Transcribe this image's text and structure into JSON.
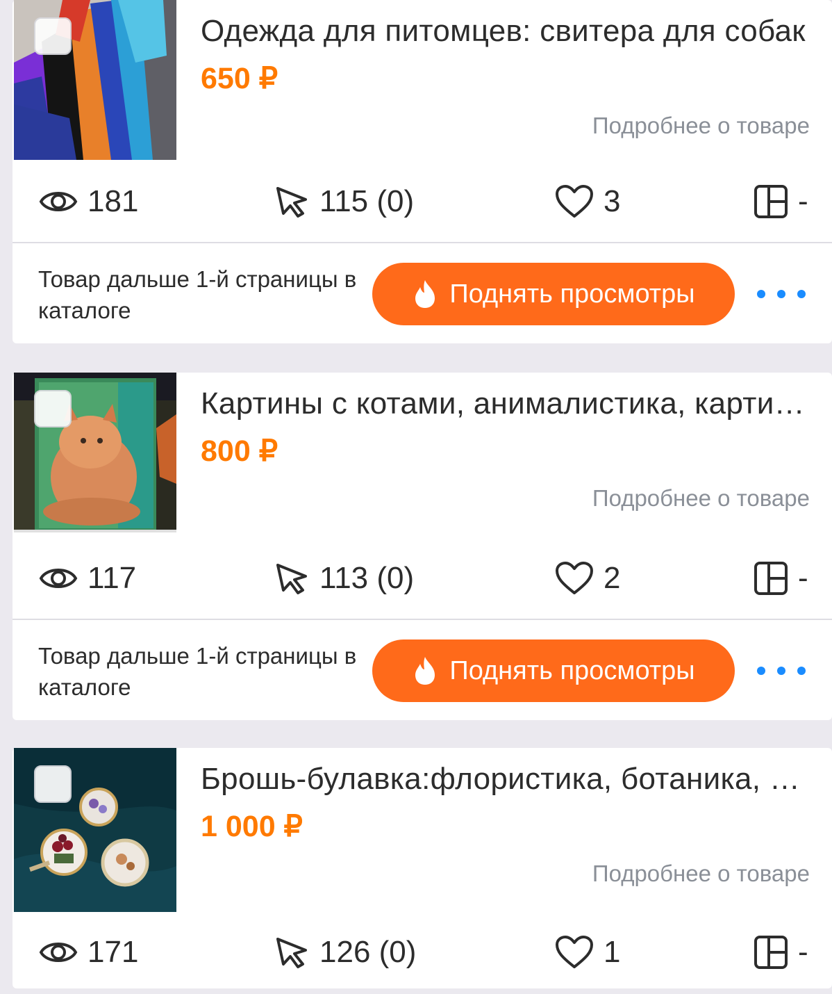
{
  "listings": [
    {
      "title": "Одежда для питомцев: свитера для собак",
      "price": "650 ₽",
      "details_link": "Подробнее о товаре",
      "views": "181",
      "clicks": "115 (0)",
      "likes": "3",
      "layout_value": "-",
      "promo_text": "Товар дальше 1-й страницы в каталоге",
      "boost_label": "Поднять просмотры"
    },
    {
      "title": "Картины с котами, анималистика, картины маслом",
      "price": "800 ₽",
      "details_link": "Подробнее о товаре",
      "views": "117",
      "clicks": "113 (0)",
      "likes": "2",
      "layout_value": "-",
      "promo_text": "Товар дальше 1-й страницы в каталоге",
      "boost_label": "Поднять просмотры"
    },
    {
      "title": "Брошь-булавка:флористика, ботаника, вышивка",
      "price": "1 000 ₽",
      "details_link": "Подробнее о товаре",
      "views": "171",
      "clicks": "126 (0)",
      "likes": "1",
      "layout_value": "-"
    }
  ],
  "colors": {
    "accent_orange": "#ff7a00",
    "button_orange": "#ff6a1a",
    "more_dots_blue": "#1a8cff",
    "background": "#ebe9ef"
  },
  "icons": [
    "eye-icon",
    "cursor-icon",
    "heart-icon",
    "layout-grid-icon",
    "fire-icon",
    "more-dots-icon"
  ]
}
